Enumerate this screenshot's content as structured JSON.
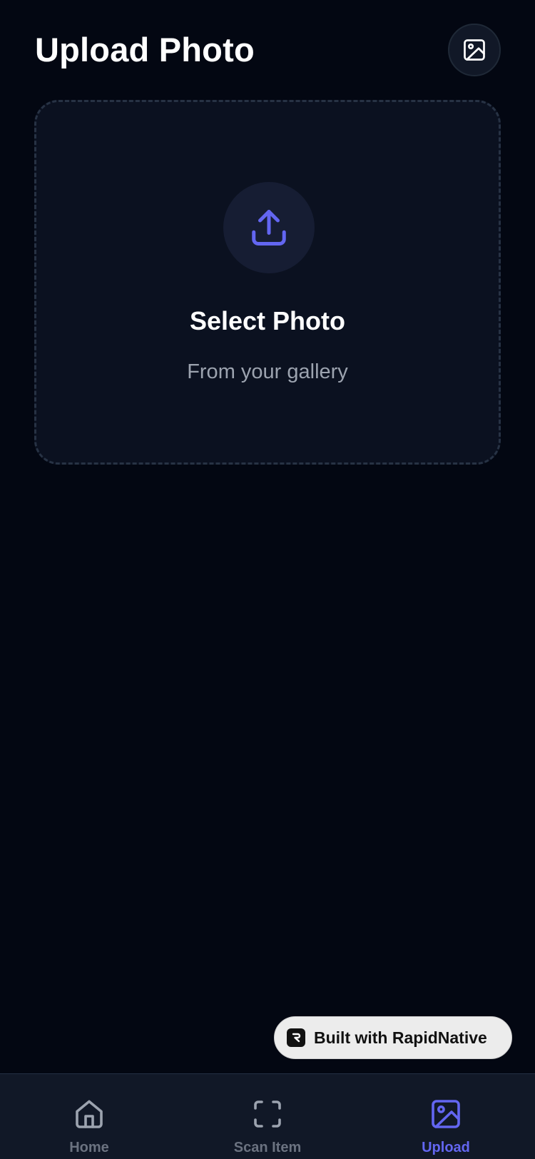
{
  "header": {
    "title": "Upload Photo",
    "action_icon": "image-icon"
  },
  "dropzone": {
    "icon": "upload-icon",
    "title": "Select Photo",
    "subtitle": "From your gallery"
  },
  "badge": {
    "logo_icon": "rapidnative-logo-icon",
    "label": "Built with RapidNative"
  },
  "tabbar": {
    "active_index": 2,
    "tabs": [
      {
        "label": "Home",
        "icon": "home-icon"
      },
      {
        "label": "Scan Item",
        "icon": "scan-icon"
      },
      {
        "label": "Upload",
        "icon": "image-icon"
      }
    ]
  },
  "colors": {
    "background": "#030712",
    "surface": "#0b1120",
    "accent": "#6366f1",
    "muted": "#9ca3af",
    "tabbar": "#111827"
  }
}
